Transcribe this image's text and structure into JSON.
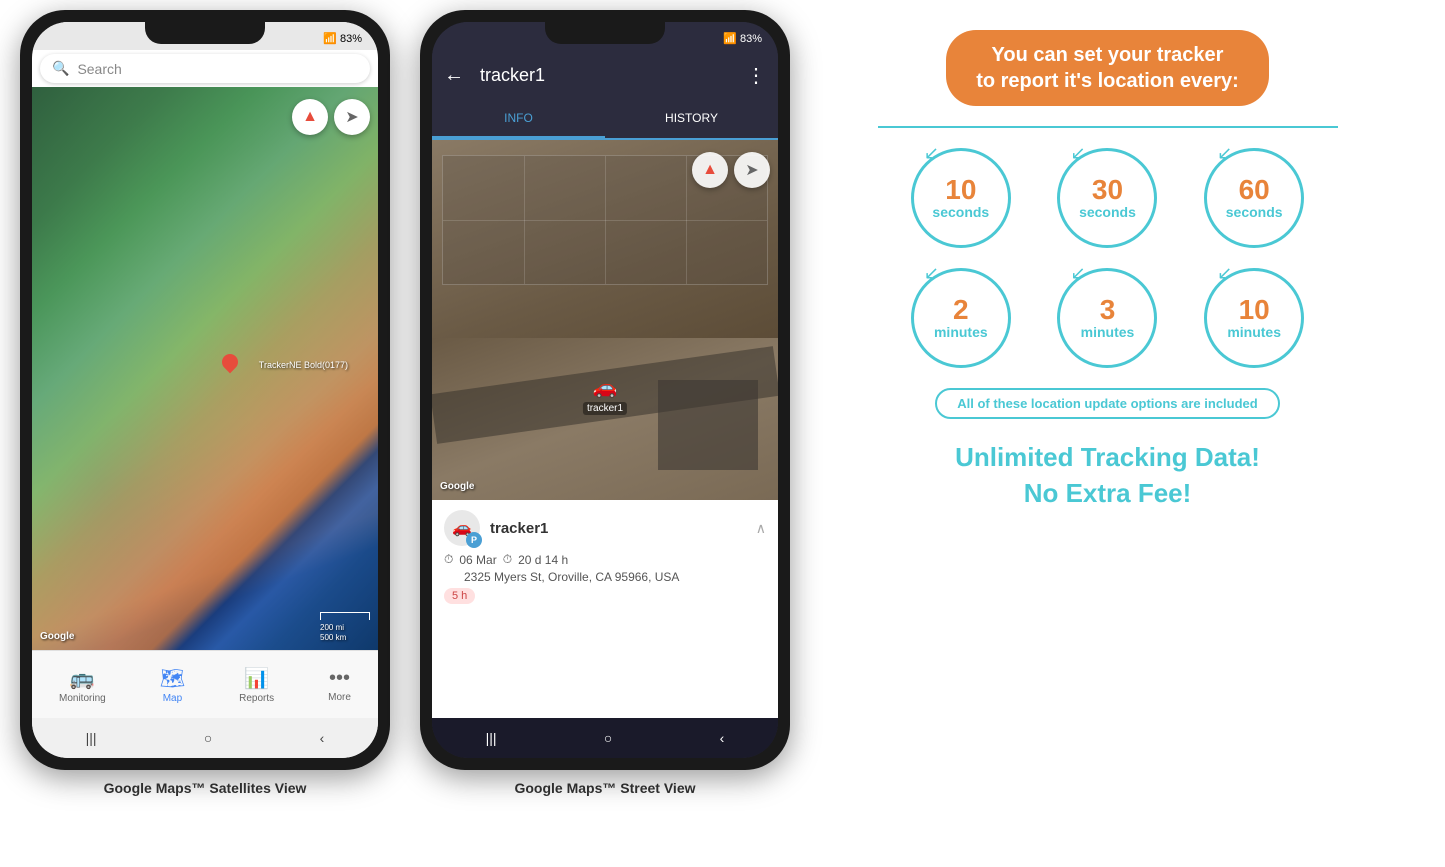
{
  "phone1": {
    "status": {
      "signal": "▲▲▲",
      "battery": "83%",
      "time": ""
    },
    "search_placeholder": "Search",
    "google_label": "Google",
    "scale_label": "200 mi\n500 km",
    "map_label": "TrackerNE Bold(0177)",
    "nav_items": [
      {
        "icon": "🚌",
        "label": "Monitoring",
        "active": false
      },
      {
        "icon": "🗺",
        "label": "Map",
        "active": true
      },
      {
        "icon": "📊",
        "label": "Reports",
        "active": false
      },
      {
        "icon": "•••",
        "label": "More",
        "active": false
      }
    ],
    "android_nav": [
      "|||",
      "○",
      "<"
    ],
    "caption": "Google Maps™ Satellites View"
  },
  "phone2": {
    "status": {
      "signal": "▲▲▲",
      "battery": "83%"
    },
    "header": {
      "title": "tracker1",
      "back_icon": "←",
      "menu_icon": "⋮"
    },
    "tabs": [
      {
        "label": "INFO",
        "active": true
      },
      {
        "label": "HISTORY",
        "active": false
      }
    ],
    "google_label": "Google",
    "tracker_label": "tracker1",
    "info_card": {
      "avatar_letter": "P",
      "title": "tracker1",
      "date": "06 Mar",
      "duration": "20 d 14 h",
      "address": "2325 Myers St, Oroville, CA 95966, USA",
      "tag": "5 h"
    },
    "android_nav": [
      "|||",
      "○",
      "<"
    ],
    "caption": "Google Maps™ Street View"
  },
  "info_panel": {
    "headline": "You can set your tracker\nto report it's location every:",
    "circles": [
      {
        "number": "10",
        "unit": "seconds"
      },
      {
        "number": "30",
        "unit": "seconds"
      },
      {
        "number": "60",
        "unit": "seconds"
      },
      {
        "number": "2",
        "unit": "minutes"
      },
      {
        "number": "3",
        "unit": "minutes"
      },
      {
        "number": "10",
        "unit": "minutes"
      }
    ],
    "included_banner": "All of these location update options are included",
    "unlimited_line1": "Unlimited Tracking Data!",
    "unlimited_line2": "No Extra Fee!"
  }
}
